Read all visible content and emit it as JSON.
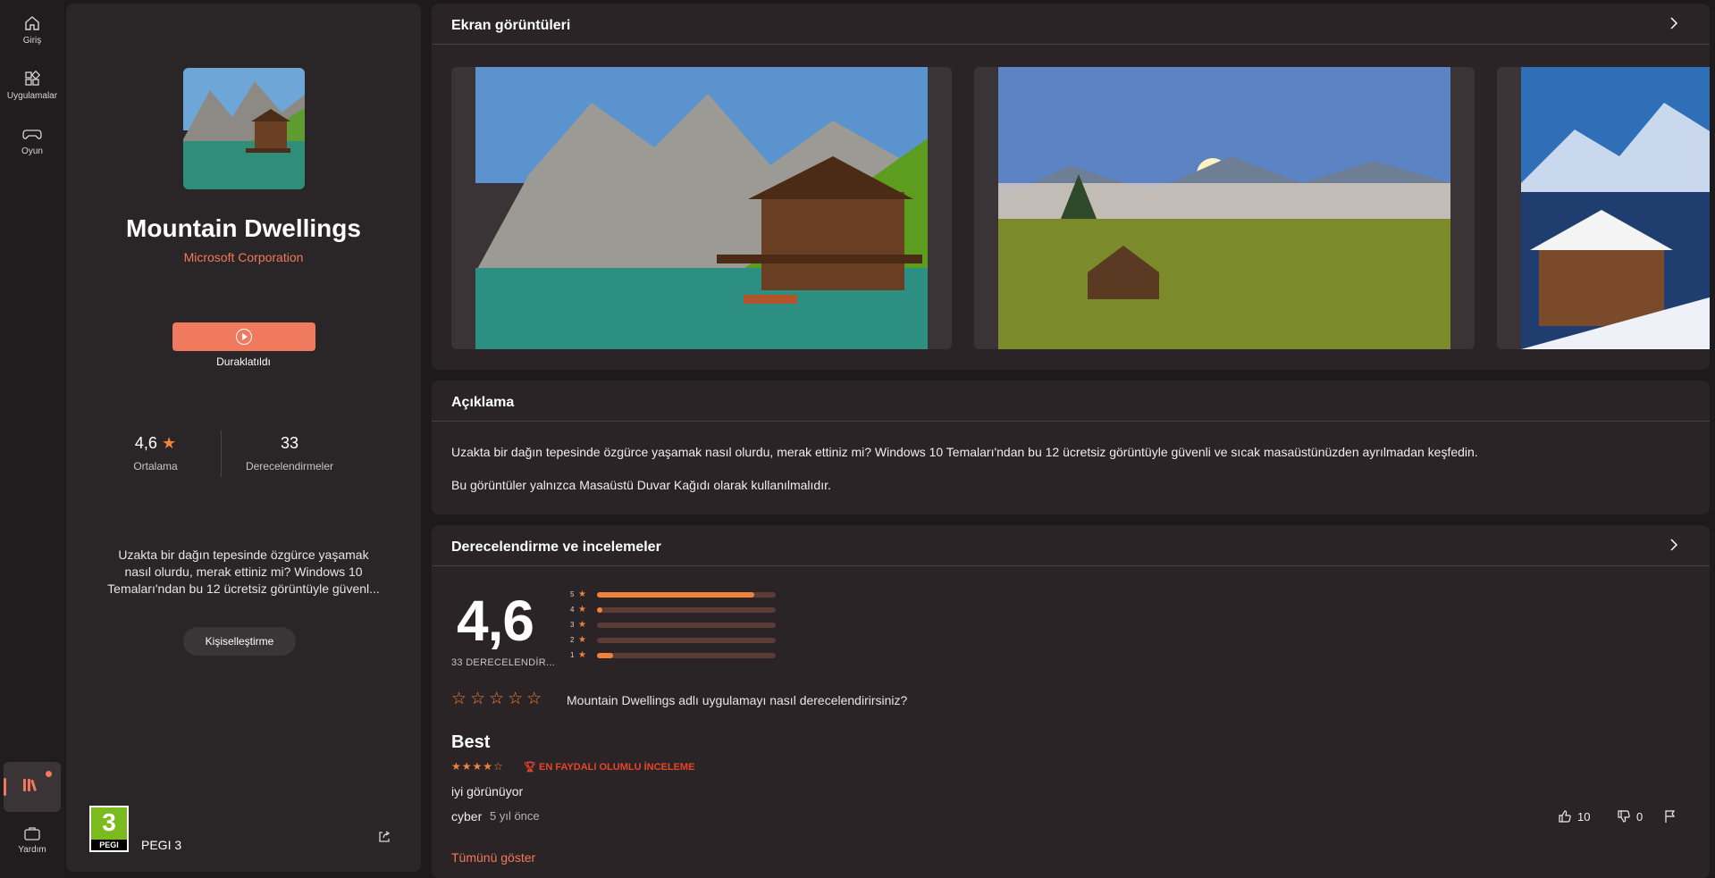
{
  "nav": {
    "home": "Giriş",
    "apps": "Uygulamalar",
    "games": "Oyun",
    "help": "Yardım"
  },
  "app": {
    "title": "Mountain Dwellings",
    "publisher": "Microsoft Corporation",
    "play_state": "Duraklatıldı",
    "rating_value": "4,6",
    "rating_label": "Ortalama",
    "ratings_count": "33",
    "ratings_label": "Derecelendirmeler",
    "short_description": "Uzakta bir dağın tepesinde özgürce yaşamak nasıl olurdu, merak ettiniz mi? Windows 10 Temaları'ndan bu 12 ücretsiz görüntüyle güvenl...",
    "category_button": "Kişiselleştirme",
    "age_rating_number": "3",
    "age_rating_brand": "PEGI",
    "age_rating_label": "PEGI 3"
  },
  "screenshots": {
    "title": "Ekran görüntüleri"
  },
  "description": {
    "title": "Açıklama",
    "p1": "Uzakta bir dağın tepesinde özgürce yaşamak nasıl olurdu, merak ettiniz mi? Windows 10 Temaları'ndan bu 12 ücretsiz görüntüyle güvenli ve sıcak masaüstünüzden ayrılmadan keşfedin.",
    "p2": "Bu görüntüler yalnızca Masaüstü Duvar Kağıdı olarak kullanılmalıdır."
  },
  "ratings": {
    "title": "Derecelendirme ve incelemeler",
    "average": "4,6",
    "count_label": "33 DERECELENDİR...",
    "histogram": [
      {
        "stars": "5",
        "fraction": 0.88
      },
      {
        "stars": "4",
        "fraction": 0.03
      },
      {
        "stars": "3",
        "fraction": 0.0
      },
      {
        "stars": "2",
        "fraction": 0.0
      },
      {
        "stars": "1",
        "fraction": 0.09
      }
    ],
    "rate_prompt": "Mountain Dwellings adlı uygulamayı nasıl derecelendirirsiniz?",
    "review": {
      "title": "Best",
      "stars": 4,
      "badge": "EN FAYDALI OLUMLU İNCELEME",
      "body": "iyi görünüyor",
      "author": "cyber",
      "time": "5 yıl önce",
      "likes": "10",
      "dislikes": "0"
    },
    "show_all": "Tümünü göster"
  },
  "colors": {
    "accent": "#ef7a5e",
    "star": "#f0823c",
    "badge": "#e8442a",
    "pegi_green": "#7cbb1e"
  }
}
